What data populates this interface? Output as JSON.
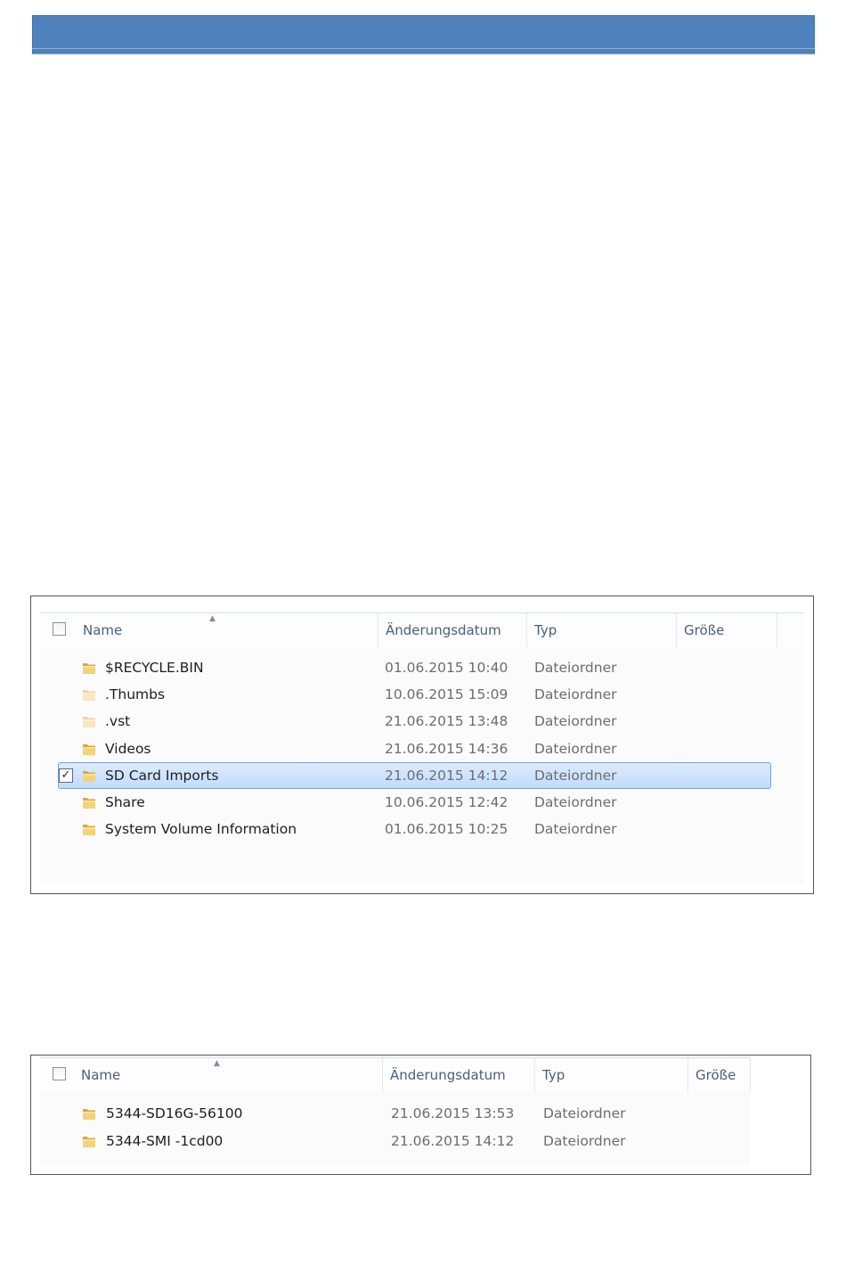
{
  "explorer_top": {
    "columns": {
      "name": "Name",
      "date": "Änderungsdatum",
      "type": "Typ",
      "size": "Größe"
    },
    "rows": [
      {
        "name": "$RECYCLE.BIN",
        "date": "01.06.2015 10:40",
        "type": "Dateiordner",
        "faded": false,
        "selected": false
      },
      {
        "name": ".Thumbs",
        "date": "10.06.2015 15:09",
        "type": "Dateiordner",
        "faded": true,
        "selected": false
      },
      {
        "name": ".vst",
        "date": "21.06.2015 13:48",
        "type": "Dateiordner",
        "faded": true,
        "selected": false
      },
      {
        "name": "Videos",
        "date": "21.06.2015 14:36",
        "type": "Dateiordner",
        "faded": false,
        "selected": false
      },
      {
        "name": "SD Card Imports",
        "date": "21.06.2015 14:12",
        "type": "Dateiordner",
        "faded": false,
        "selected": true
      },
      {
        "name": "Share",
        "date": "10.06.2015 12:42",
        "type": "Dateiordner",
        "faded": false,
        "selected": false
      },
      {
        "name": "System Volume Information",
        "date": "01.06.2015 10:25",
        "type": "Dateiordner",
        "faded": false,
        "selected": false
      }
    ]
  },
  "explorer_bottom": {
    "columns": {
      "name": "Name",
      "date": "Änderungsdatum",
      "type": "Typ",
      "size": "Größe"
    },
    "rows": [
      {
        "name": "5344-SD16G-56100",
        "date": "21.06.2015 13:53",
        "type": "Dateiordner"
      },
      {
        "name": "5344-SMI  -1cd00",
        "date": "21.06.2015 14:12",
        "type": "Dateiordner"
      }
    ]
  },
  "colors": {
    "header_bar": "#4f81bd",
    "selection": "#c1dcfc",
    "folder": "#e8c35a"
  },
  "icons": {
    "folder": "folder-icon",
    "sort": "sort-up-arrow-icon",
    "checkbox": "checkbox-icon"
  }
}
